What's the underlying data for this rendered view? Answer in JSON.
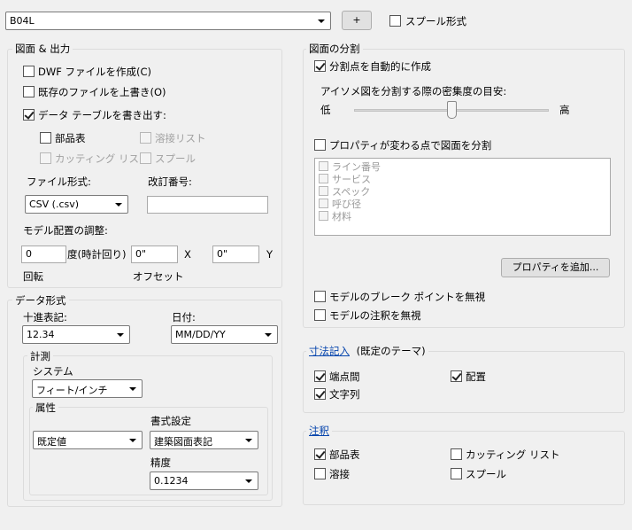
{
  "top": {
    "sheet_value": "B04L",
    "add_label": "+",
    "spool_format_label": "スプール形式"
  },
  "drawing_output": {
    "title": "図面 & 出力",
    "dwf_label": "DWF ファイルを作成(C)",
    "overwrite_label": "既存のファイルを上書き(O)",
    "export_table_label": "データ テーブルを書き出す:",
    "bom_label": "部品表",
    "weld_list_label": "溶接リスト",
    "cut_list_label": "カッティング リスト",
    "spool_label": "スプール",
    "file_format_label": "ファイル形式:",
    "file_format_value": "CSV (.csv)",
    "revision_label": "改訂番号:",
    "revision_value": "",
    "model_adjust_label": "モデル配置の調整:",
    "rotation_value": "0",
    "rotation_unit": "度(時計回り)",
    "offset_x_value": "0\"",
    "x_label": "X",
    "offset_y_value": "0\"",
    "y_label": "Y",
    "rotation_caption": "回転",
    "offset_caption": "オフセット"
  },
  "data_format": {
    "title": "データ形式",
    "decimal_label": "十進表記:",
    "decimal_value": "12.34",
    "date_label": "日付:",
    "date_value": "MM/DD/YY",
    "measure_title": "計測",
    "system_label": "システム",
    "system_value": "フィート/インチ",
    "attribute_title": "属性",
    "attribute_value": "既定値",
    "style_label": "書式設定",
    "style_value": "建築図面表記",
    "precision_label": "精度",
    "precision_value": "0.1234"
  },
  "split": {
    "title": "図面の分割",
    "auto_split_label": "分割点を自動的に作成",
    "density_label": "アイソメ図を分割する際の密集度の目安:",
    "low_label": "低",
    "high_label": "高",
    "density_value": 0.5,
    "property_split_label": "プロパティが変わる点で図面を分割",
    "properties": [
      "ライン番号",
      "サービス",
      "スペック",
      "呼び径",
      "材料"
    ],
    "add_property_label": "プロパティを追加...",
    "ignore_breakpoints_label": "モデルのブレーク ポイントを無視",
    "ignore_annotations_label": "モデルの注釈を無視"
  },
  "dimension": {
    "link_label": "寸法記入",
    "theme_label": "(既定のテーマ)",
    "endpoints_label": "端点間",
    "placement_label": "配置",
    "strings_label": "文字列"
  },
  "annotation": {
    "link_label": "注釈",
    "bom_label": "部品表",
    "cut_list_label": "カッティング リスト",
    "weld_label": "溶接",
    "spool_label": "スプール"
  }
}
